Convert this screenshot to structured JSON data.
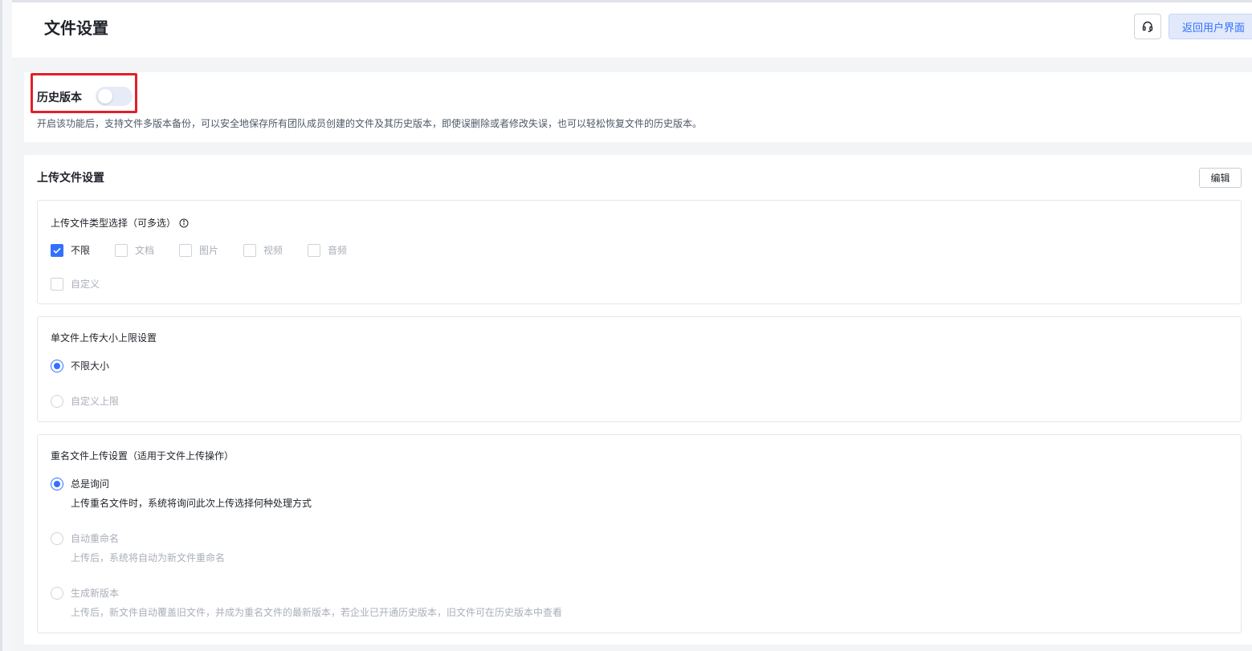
{
  "header": {
    "title": "文件设置",
    "back_label": "返回用户界面"
  },
  "history": {
    "label": "历史版本",
    "enabled": false,
    "description": "开启该功能后，支持文件多版本备份，可以安全地保存所有团队成员创建的文件及其历史版本，即使误删除或者修改失误，也可以轻松恢复文件的历史版本。"
  },
  "upload": {
    "title": "上传文件设置",
    "edit_label": "编辑",
    "types": {
      "title": "上传文件类型选择（可多选）",
      "options": [
        {
          "label": "不限",
          "checked": true
        },
        {
          "label": "文档",
          "checked": false
        },
        {
          "label": "图片",
          "checked": false
        },
        {
          "label": "视频",
          "checked": false
        },
        {
          "label": "音频",
          "checked": false
        },
        {
          "label": "自定义",
          "checked": false
        }
      ]
    },
    "size": {
      "title": "单文件上传大小上限设置",
      "options": [
        {
          "label": "不限大小",
          "checked": true
        },
        {
          "label": "自定义上限",
          "checked": false
        }
      ]
    },
    "rename": {
      "title": "重名文件上传设置（适用于文件上传操作）",
      "options": [
        {
          "label": "总是询问",
          "desc": "上传重名文件时，系统将询问此次上传选择何种处理方式",
          "checked": true
        },
        {
          "label": "自动重命名",
          "desc": "上传后，系统将自动为新文件重命名",
          "checked": false
        },
        {
          "label": "生成新版本",
          "desc": "上传后，新文件自动覆盖旧文件，并成为重名文件的最新版本，若企业已开通历史版本，旧文件可在历史版本中查看",
          "checked": false
        }
      ]
    }
  },
  "colors": {
    "accent": "#3370ff",
    "highlight": "#e0202a"
  }
}
